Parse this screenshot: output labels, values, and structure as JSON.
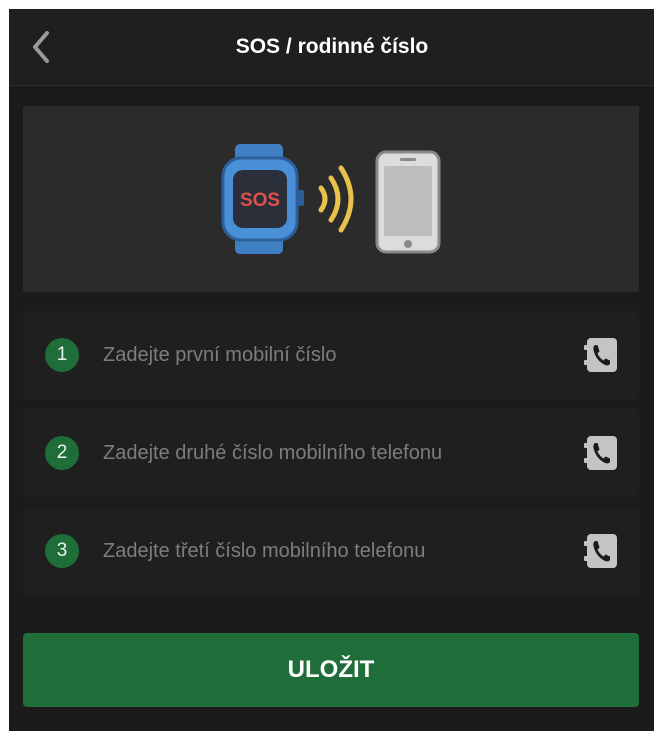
{
  "header": {
    "title": "SOS / rodinné číslo",
    "back_icon": "chevron-left-icon"
  },
  "banner": {
    "watch_screen_text": "SOS",
    "icons": [
      "smartwatch-icon",
      "signal-waves-icon",
      "smartphone-icon"
    ]
  },
  "contacts": [
    {
      "number": "1",
      "placeholder": "Zadejte první mobilní číslo",
      "icon": "contact-book-icon"
    },
    {
      "number": "2",
      "placeholder": "Zadejte druhé číslo mobilního telefonu",
      "icon": "contact-book-icon"
    },
    {
      "number": "3",
      "placeholder": "Zadejte třetí číslo mobilního telefonu",
      "icon": "contact-book-icon"
    }
  ],
  "save_button": {
    "label": "ULOŽIT"
  },
  "colors": {
    "background": "#1b1b1b",
    "accent_green": "#1f6e3a",
    "placeholder_text": "#7d7d7d",
    "watch_blue": "#4a90d9",
    "signal_yellow": "#e8c24a"
  }
}
